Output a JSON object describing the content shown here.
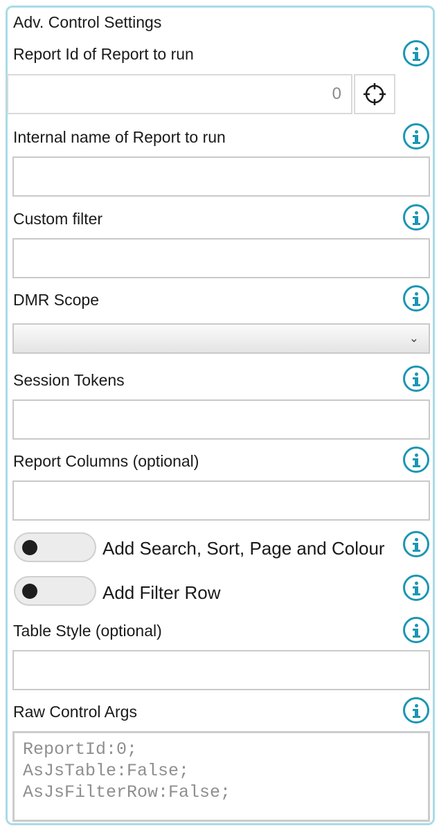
{
  "panel": {
    "title": "Adv. Control Settings"
  },
  "fields": {
    "report_id": {
      "label": "Report Id of Report to run",
      "value": "0"
    },
    "internal_name": {
      "label": "Internal name of Report to run",
      "value": ""
    },
    "custom_filter": {
      "label": "Custom filter",
      "value": ""
    },
    "dmr_scope": {
      "label": "DMR Scope",
      "selected": ""
    },
    "session_tokens": {
      "label": "Session Tokens",
      "value": ""
    },
    "report_columns": {
      "label": "Report Columns (optional)",
      "value": ""
    },
    "table_style": {
      "label": "Table Style (optional)",
      "value": ""
    },
    "raw_args": {
      "label": "Raw Control Args",
      "value": "ReportId:0;\nAsJsTable:False;\nAsJsFilterRow:False;"
    }
  },
  "toggles": {
    "search_sort": {
      "label": "Add Search, Sort, Page and Colour",
      "on": false
    },
    "filter_row": {
      "label": "Add Filter Row",
      "on": false
    }
  },
  "icons": {
    "info": "info-icon",
    "picker": "crosshair-icon",
    "dropdown": "chevron-down-icon"
  },
  "colors": {
    "accent": "#1a96b4",
    "panel_border": "#a9dbe8"
  }
}
